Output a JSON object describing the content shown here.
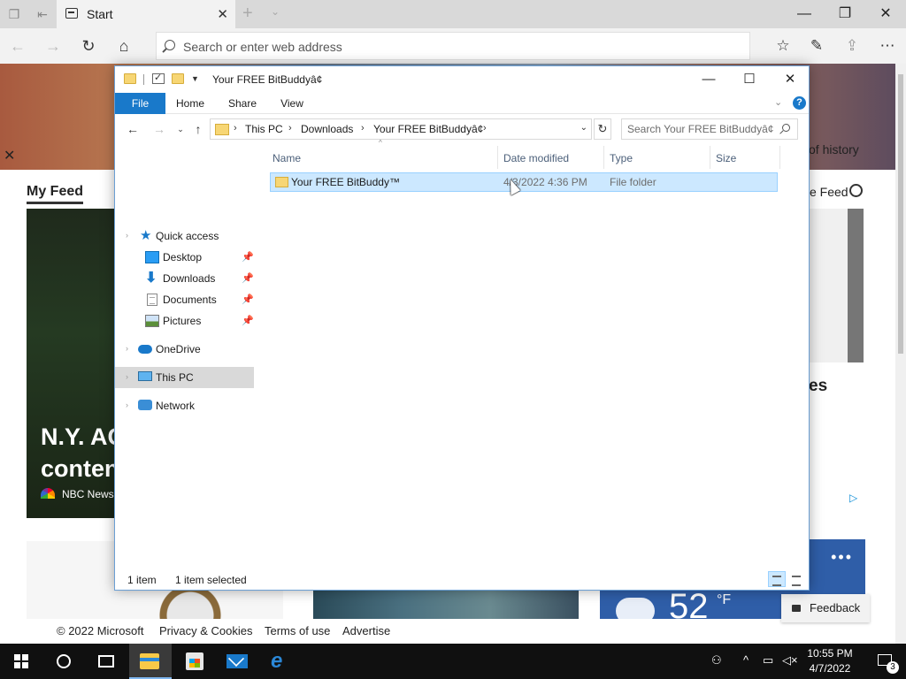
{
  "browser": {
    "tab_title": "Start",
    "address_placeholder": "Search or enter web address"
  },
  "page": {
    "hero_caption": "of history",
    "feed_title": "My Feed",
    "feed_right_label": "e Feed",
    "news_headline_line1": "N.Y. AG",
    "news_headline_line2": "conten",
    "news_source": "NBC News",
    "right_card_text": "es",
    "weather_temp": "52",
    "weather_unit": "°F",
    "feedback_label": "Feedback",
    "footer": {
      "copyright": "© 2022 Microsoft",
      "privacy": "Privacy & Cookies",
      "terms": "Terms of use",
      "advertise": "Advertise"
    }
  },
  "explorer": {
    "title": "Your FREE BitBuddyâ¢",
    "ribbon_tabs": [
      "File",
      "Home",
      "Share",
      "View"
    ],
    "breadcrumb": [
      "This PC",
      "Downloads",
      "Your FREE BitBuddyâ¢"
    ],
    "search_placeholder": "Search Your FREE BitBuddyâ¢",
    "nav_pane": {
      "quick_access": "Quick access",
      "desktop": "Desktop",
      "downloads": "Downloads",
      "documents": "Documents",
      "pictures": "Pictures",
      "onedrive": "OneDrive",
      "this_pc": "This PC",
      "network": "Network"
    },
    "columns": [
      "Name",
      "Date modified",
      "Type",
      "Size"
    ],
    "files": [
      {
        "name": "Your FREE BitBuddy™",
        "date_modified": "4/3/2022 4:36 PM",
        "type": "File folder",
        "size": "",
        "selected": true
      }
    ],
    "status": {
      "item_count": "1 item",
      "selection": "1 item selected"
    }
  },
  "taskbar": {
    "time": "10:55 PM",
    "date": "4/7/2022",
    "notification_count": "3"
  },
  "colors": {
    "ribbon_file_tab": "#1979ca",
    "selection_bg": "#cce8ff",
    "selection_border": "#99d1ff",
    "weather_card": "#2f5ea8",
    "taskbar": "#101010"
  }
}
